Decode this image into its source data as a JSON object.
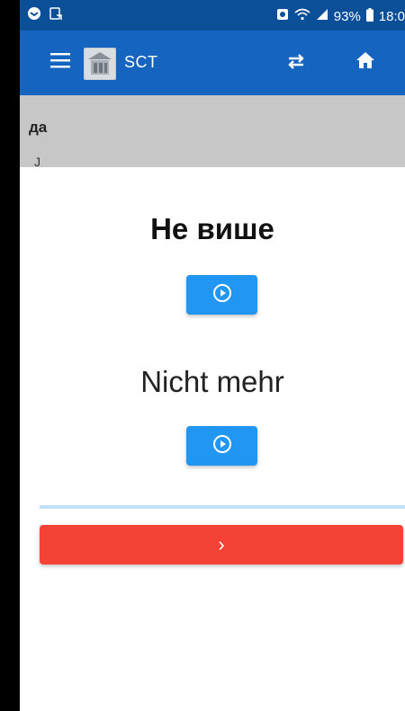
{
  "status_bar": {
    "battery": "93%",
    "time": "18:0",
    "icons": [
      "notification-icon",
      "cast-icon",
      "alarm-icon",
      "wifi-icon",
      "signal-icon",
      "battery-icon"
    ]
  },
  "app_bar": {
    "title": "SCT",
    "icons": [
      "menu-icon",
      "logo",
      "swap-icon",
      "home-icon"
    ],
    "color": "#1565c0"
  },
  "background_page": {
    "word": "да",
    "partial_text": "Ja"
  },
  "card": {
    "word": "Не више",
    "translation": "Nicht mehr",
    "play_icon": "play-circle-icon",
    "next_label": "›",
    "progress": 1.0
  },
  "colors": {
    "accent": "#2196f3",
    "next": "#f44336",
    "progress_track": "#bfe0f6"
  }
}
